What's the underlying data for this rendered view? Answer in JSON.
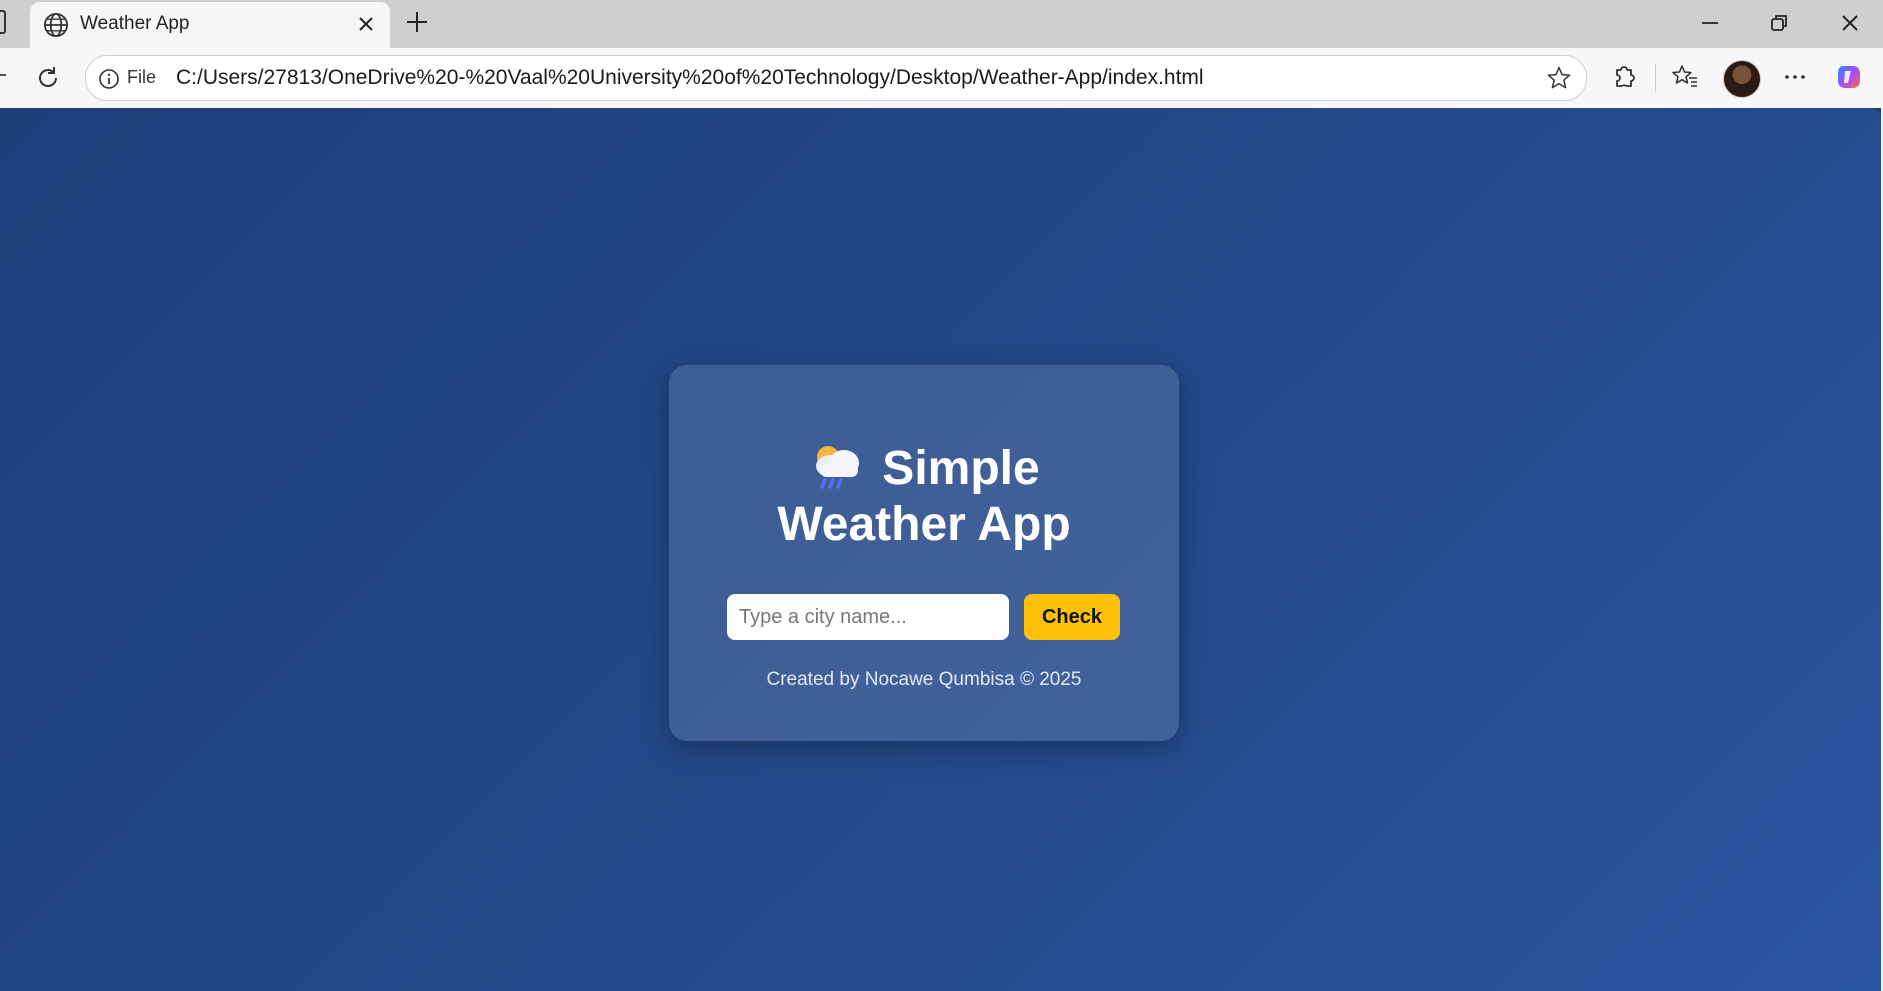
{
  "browser": {
    "tab": {
      "title": "Weather App"
    },
    "address_bar": {
      "scheme_label": "File",
      "url": "C:/Users/27813/OneDrive%20-%20Vaal%20University%20of%20Technology/Desktop/Weather-App/index.html"
    },
    "icons": [
      "globe-icon",
      "close-icon",
      "new-tab-icon",
      "minimize-icon",
      "restore-icon",
      "window-close-icon",
      "reload-icon",
      "info-icon",
      "favorite-star-icon",
      "extensions-icon",
      "favorites-icon",
      "profile-avatar",
      "more-icon",
      "copilot-icon"
    ]
  },
  "page": {
    "background": "#24498a",
    "card": {
      "emoji": "🌧️",
      "title_line1": "Simple",
      "title_line2": "Weather App",
      "city_input": {
        "value": "",
        "placeholder": "Type a city name..."
      },
      "check_button": {
        "label": "Check",
        "color": "#ffc107"
      },
      "footer": "Created by Nocawe Qumbisa © 2025"
    }
  }
}
